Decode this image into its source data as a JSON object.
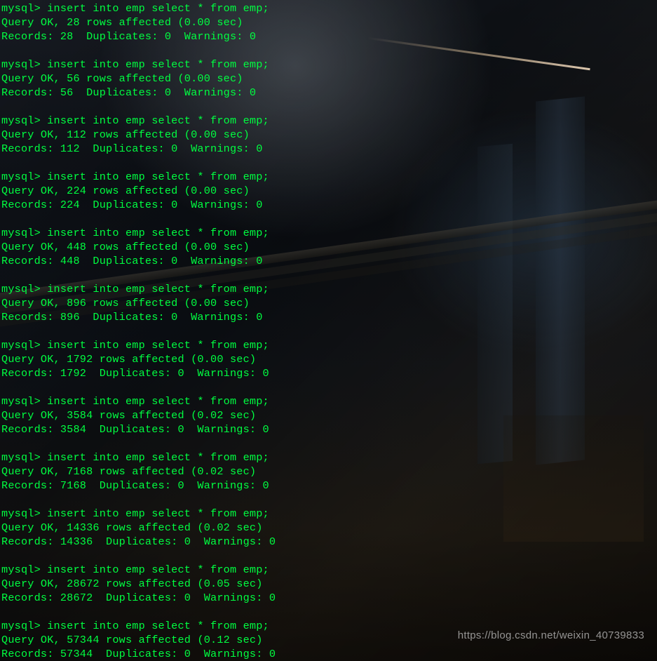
{
  "terminal": {
    "prompt": "mysql>",
    "command": "insert into emp select * from emp;",
    "blocks": [
      {
        "rows": "28",
        "sec": "0.00",
        "records": "28"
      },
      {
        "rows": "56",
        "sec": "0.00",
        "records": "56"
      },
      {
        "rows": "112",
        "sec": "0.00",
        "records": "112"
      },
      {
        "rows": "224",
        "sec": "0.00",
        "records": "224"
      },
      {
        "rows": "448",
        "sec": "0.00",
        "records": "448"
      },
      {
        "rows": "896",
        "sec": "0.00",
        "records": "896"
      },
      {
        "rows": "1792",
        "sec": "0.00",
        "records": "1792"
      },
      {
        "rows": "3584",
        "sec": "0.02",
        "records": "3584"
      },
      {
        "rows": "7168",
        "sec": "0.02",
        "records": "7168"
      },
      {
        "rows": "14336",
        "sec": "0.02",
        "records": "14336"
      },
      {
        "rows": "28672",
        "sec": "0.05",
        "records": "28672"
      },
      {
        "rows": "57344",
        "sec": "0.12",
        "records": "57344"
      }
    ],
    "duplicates": "0",
    "warnings": "0",
    "labels": {
      "query_ok": "Query OK,",
      "rows_affected": "rows affected",
      "records": "Records:",
      "duplicates_lbl": "Duplicates:",
      "warnings_lbl": "Warnings:"
    }
  },
  "watermark": "https://blog.csdn.net/weixin_40739833"
}
